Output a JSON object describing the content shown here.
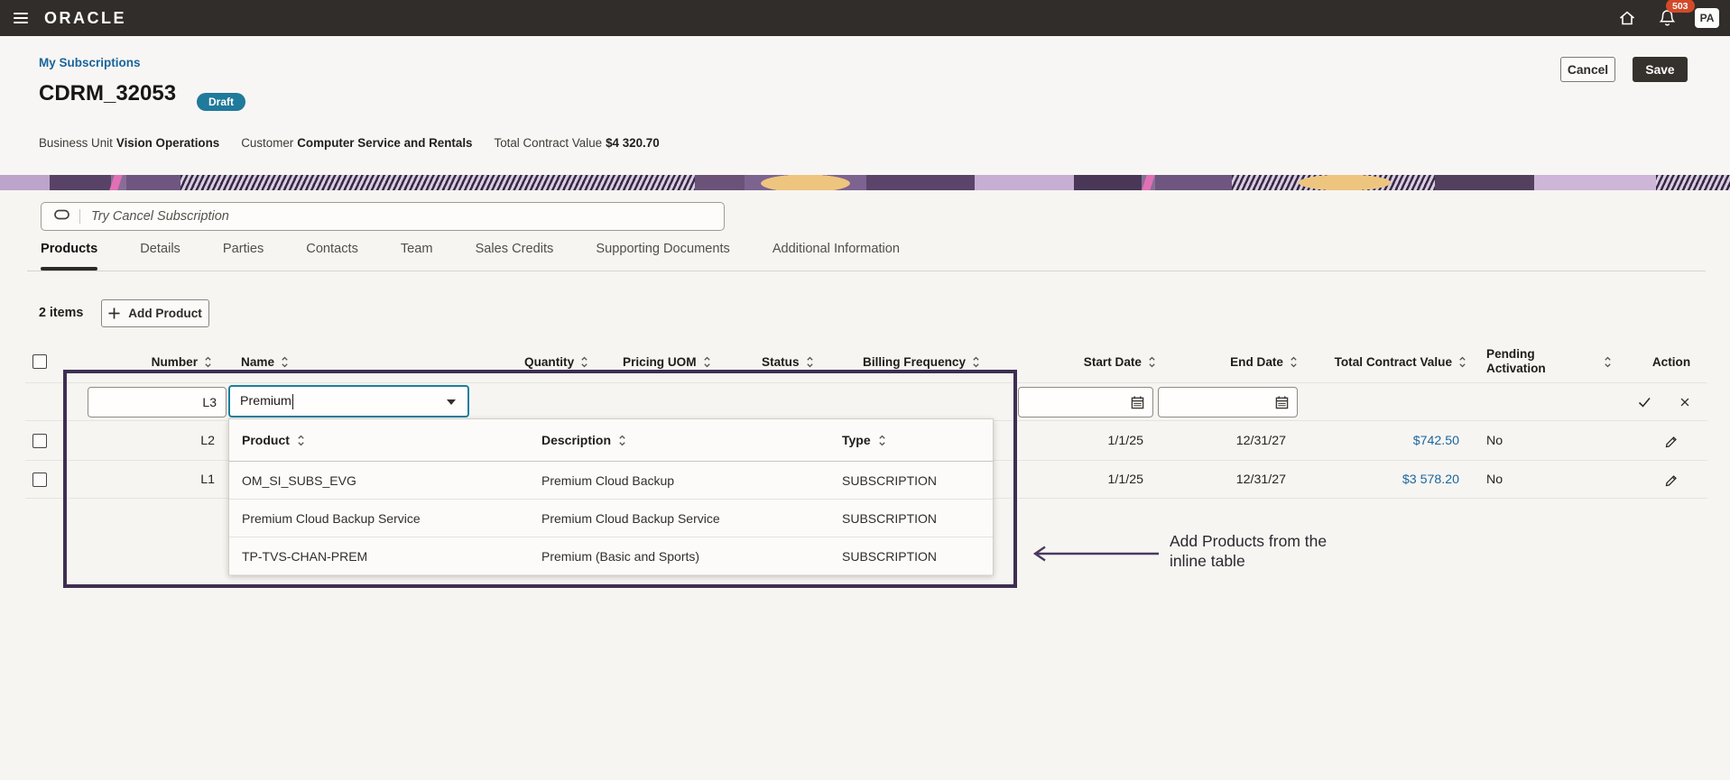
{
  "topbar": {
    "brand": "ORACLE",
    "notification_count": "503",
    "avatar_initials": "PA",
    "icons": [
      "hamburger-icon",
      "home-icon",
      "bell-icon"
    ]
  },
  "header": {
    "breadcrumb": "My Subscriptions",
    "title": "CDRM_32053",
    "status_badge": "Draft",
    "cancel_label": "Cancel",
    "save_label": "Save",
    "meta": [
      {
        "label": "Business Unit",
        "value": "Vision Operations"
      },
      {
        "label": "Customer",
        "value": "Computer Service and Rentals"
      },
      {
        "label": "Total Contract Value",
        "value": "$4 320.70"
      }
    ]
  },
  "search": {
    "placeholder": "Try Cancel Subscription",
    "icon": "assistant-pill-icon"
  },
  "tabs": [
    {
      "label": "Products",
      "active": true
    },
    {
      "label": "Details",
      "active": false
    },
    {
      "label": "Parties",
      "active": false
    },
    {
      "label": "Contacts",
      "active": false
    },
    {
      "label": "Team",
      "active": false
    },
    {
      "label": "Sales Credits",
      "active": false
    },
    {
      "label": "Supporting Documents",
      "active": false
    },
    {
      "label": "Additional Information",
      "active": false
    }
  ],
  "toolbar": {
    "items_count": "2 items",
    "add_label": "Add Product"
  },
  "products_table": {
    "headers": {
      "number": "Number",
      "name": "Name",
      "quantity": "Quantity",
      "pricing_uom": "Pricing UOM",
      "status": "Status",
      "billing_frequency": "Billing Frequency",
      "start_date": "Start Date",
      "end_date": "End Date",
      "total_contract_value": "Total Contract Value",
      "pending_activation": "Pending Activation",
      "action": "Action"
    },
    "edit_row": {
      "number": "L3",
      "name_query": "Premium",
      "start_date": "",
      "end_date": ""
    },
    "rows": [
      {
        "number": "L2",
        "start_date": "1/1/25",
        "end_date": "12/31/27",
        "total_contract_value": "$742.50",
        "pending_activation": "No"
      },
      {
        "number": "L1",
        "start_date": "1/1/25",
        "end_date": "12/31/27",
        "total_contract_value": "$3 578.20",
        "pending_activation": "No"
      }
    ]
  },
  "product_dropdown": {
    "headers": {
      "product": "Product",
      "description": "Description",
      "type": "Type"
    },
    "rows": [
      {
        "product": "OM_SI_SUBS_EVG",
        "description": "Premium Cloud Backup",
        "type": "SUBSCRIPTION"
      },
      {
        "product": "Premium Cloud Backup Service",
        "description": "Premium Cloud Backup Service",
        "type": "SUBSCRIPTION"
      },
      {
        "product": "TP-TVS-CHAN-PREM",
        "description": "Premium (Basic and Sports)",
        "type": "SUBSCRIPTION"
      }
    ]
  },
  "annotation": {
    "line1": "Add Products from the",
    "line2": "inline table"
  },
  "colors": {
    "topbar_bg": "#312d2a",
    "link_blue": "#1a669e",
    "draft_badge": "#1f7a9b",
    "notification_badge": "#d24a28",
    "focus_border": "#1b7f9e",
    "annotation_purple": "#3f2e52"
  }
}
